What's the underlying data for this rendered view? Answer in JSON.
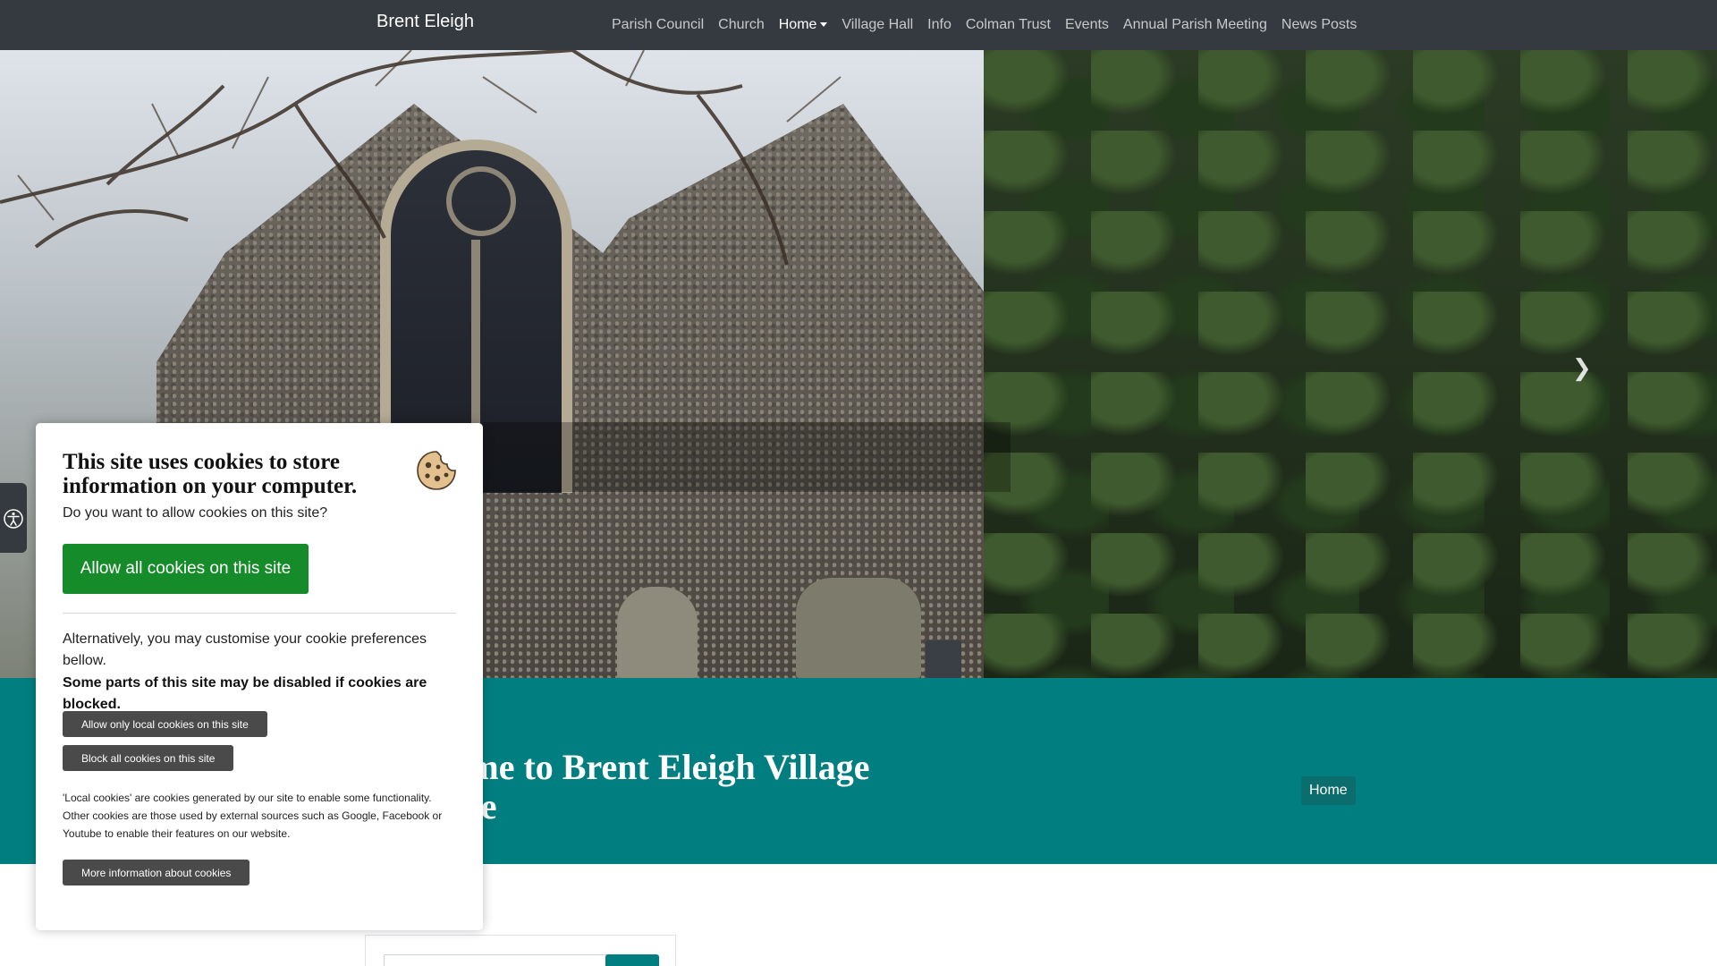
{
  "navbar": {
    "brand": "Brent Eleigh",
    "links": [
      "Parish Council",
      "Church",
      "Home",
      "Village Hall",
      "Info",
      "Colman Trust",
      "Events",
      "Annual Parish Meeting",
      "News Posts"
    ],
    "active_link": "Home"
  },
  "hero": {
    "next_icon": "chevron-right-icon"
  },
  "page_header": {
    "title": "Welcome to Brent Eleigh Village Website",
    "breadcrumb": "Home"
  },
  "cookie_dialog": {
    "title": "This site uses cookies to store information on your computer.",
    "question": "Do you want to allow cookies on this site?",
    "allow_all": "Allow all cookies on this site",
    "alternative": "Alternatively, you may customise your cookie preferences bellow.",
    "warning": "Some parts of this site may be disabled if cookies are blocked.",
    "allow_local": "Allow only local cookies on this site",
    "block_all": "Block all cookies on this site",
    "note": "'Local cookies' are cookies generated by our site to enable some functionality. Other cookies are those used by external sources such as Google, Facebook or Youtube to enable their features on our website.",
    "more_info": "More information about cookies"
  },
  "colors": {
    "navbar": "#343a40",
    "teal": "#017f80",
    "allow_green": "#168b2a",
    "button_grey": "#4a4a4a"
  }
}
